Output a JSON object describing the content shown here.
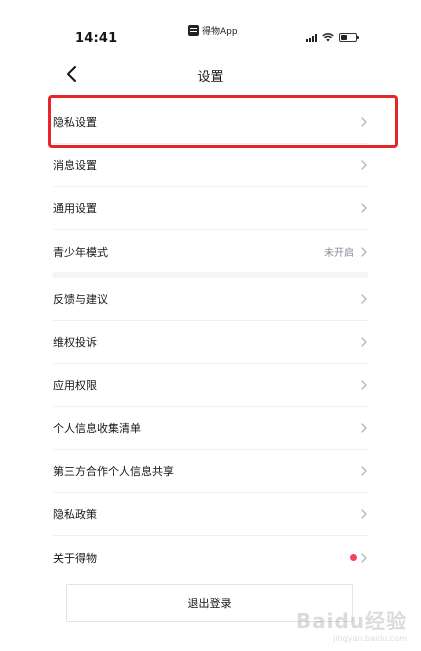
{
  "status_bar": {
    "time": "14:41",
    "app_badge": "得物App",
    "battery_level": 0.4
  },
  "nav": {
    "title": "设置",
    "back_icon": "chevron-left-icon"
  },
  "group1": [
    {
      "name": "privacy-settings",
      "label": "隐私设置",
      "value": ""
    },
    {
      "name": "message-settings",
      "label": "消息设置",
      "value": ""
    },
    {
      "name": "general-settings",
      "label": "通用设置",
      "value": ""
    },
    {
      "name": "teen-mode",
      "label": "青少年模式",
      "value": "未开启"
    }
  ],
  "group2": [
    {
      "name": "feedback",
      "label": "反馈与建议",
      "value": ""
    },
    {
      "name": "rights-complaint",
      "label": "维权投诉",
      "value": ""
    },
    {
      "name": "app-permissions",
      "label": "应用权限",
      "value": ""
    },
    {
      "name": "personal-info-collection-list",
      "label": "个人信息收集清单",
      "value": ""
    },
    {
      "name": "third-party-info-sharing",
      "label": "第三方合作个人信息共享",
      "value": ""
    },
    {
      "name": "privacy-policy",
      "label": "隐私政策",
      "value": ""
    },
    {
      "name": "about-dewu",
      "label": "关于得物",
      "value": "",
      "dot": true
    }
  ],
  "logout_label": "退出登录",
  "watermark": {
    "brand": "Baidu经验",
    "url": "jingyan.baidu.com"
  },
  "colors": {
    "highlight": "#e5262b",
    "dot": "#f0475a",
    "chevron": "#b4b4bd",
    "separator": "#f5f5f9"
  }
}
